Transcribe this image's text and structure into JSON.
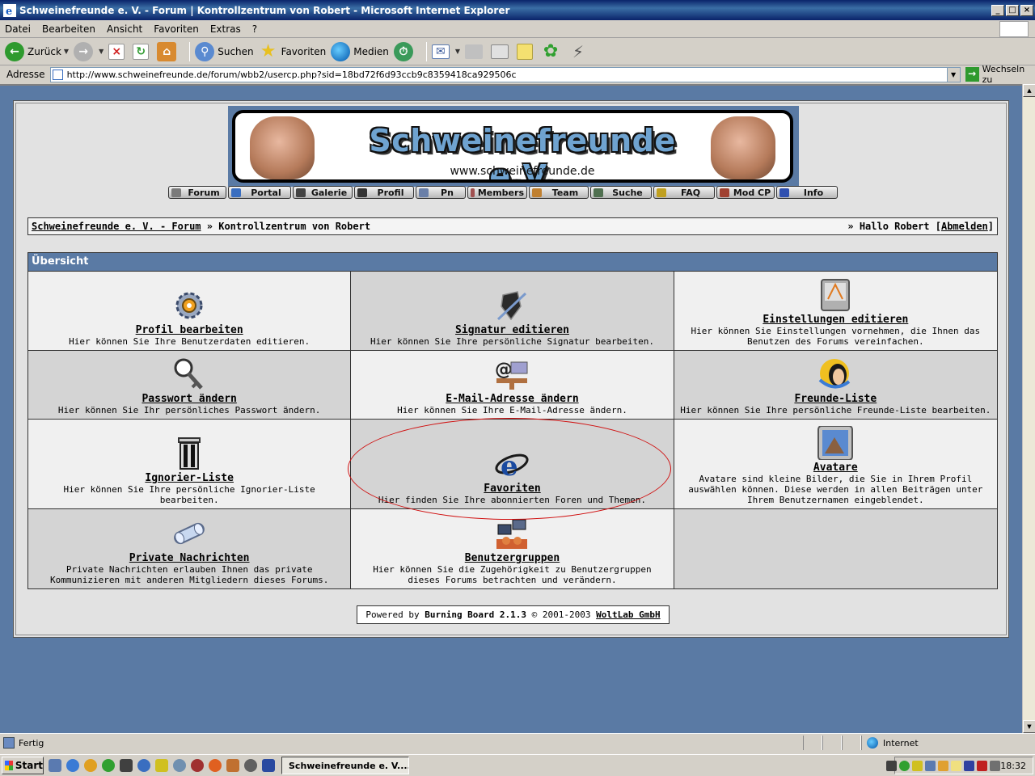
{
  "window": {
    "title": "Schweinefreunde e. V. - Forum | Kontrollzentrum von Robert - Microsoft Internet Explorer",
    "controls": [
      "_",
      "□",
      "×"
    ]
  },
  "menu": {
    "items": [
      "Datei",
      "Bearbeiten",
      "Ansicht",
      "Favoriten",
      "Extras",
      "?"
    ]
  },
  "toolbar": {
    "back": "Zurück",
    "search": "Suchen",
    "favorites": "Favoriten",
    "media": "Medien"
  },
  "address": {
    "label": "Adresse",
    "url": "http://www.schweinefreunde.de/forum/wbb2/usercp.php?sid=18bd72f6d93ccb9c8359418ca929506c",
    "go": "Wechseln zu"
  },
  "banner": {
    "title": "Schweinefreunde e.V.",
    "url": "www.schweinefreunde.de"
  },
  "nav": {
    "items": [
      {
        "label": "Forum",
        "icon": "forum-icon",
        "color": "#7a7a7a"
      },
      {
        "label": "Portal",
        "icon": "portal-icon",
        "color": "#3a6ec0"
      },
      {
        "label": "Galerie",
        "icon": "gallery-icon",
        "color": "#444444"
      },
      {
        "label": "Profil",
        "icon": "profile-icon",
        "color": "#333333"
      },
      {
        "label": "Pn",
        "icon": "pm-icon",
        "color": "#6a7fa8"
      },
      {
        "label": "Members",
        "icon": "members-icon",
        "color": "#a05050"
      },
      {
        "label": "Team",
        "icon": "team-icon",
        "color": "#c08030"
      },
      {
        "label": "Suche",
        "icon": "search-icon",
        "color": "#507050"
      },
      {
        "label": "FAQ",
        "icon": "faq-icon",
        "color": "#c0a020"
      },
      {
        "label": "Mod CP",
        "icon": "modcp-icon",
        "color": "#a04030"
      },
      {
        "label": "Info",
        "icon": "info-icon",
        "color": "#3050b0"
      }
    ]
  },
  "breadcrumb": {
    "home": "Schweinefreunde e. V. - Forum",
    "separator": "»",
    "current": "Kontrollzentrum von Robert",
    "greeting_prefix": "» Hallo Robert [",
    "logout": "Abmelden",
    "greeting_suffix": "]"
  },
  "overview": {
    "header": "Übersicht",
    "cells": [
      {
        "title": "Profil bearbeiten",
        "desc": "Hier können Sie Ihre Benutzerdaten editieren.",
        "icon": "gear-icon"
      },
      {
        "title": "Signatur editieren",
        "desc": "Hier können Sie Ihre persönliche Signatur bearbeiten.",
        "icon": "pen-icon"
      },
      {
        "title": "Einstellungen editieren",
        "desc": "Hier können Sie Einstellungen vornehmen, die Ihnen das Benutzen des Forums vereinfachen.",
        "icon": "settings-icon"
      },
      {
        "title": "Passwort ändern",
        "desc": "Hier können Sie Ihr persönliches Passwort ändern.",
        "icon": "key-icon"
      },
      {
        "title": "E-Mail-Adresse ändern",
        "desc": "Hier können Sie Ihre E-Mail-Adresse ändern.",
        "icon": "email-icon"
      },
      {
        "title": "Freunde-Liste",
        "desc": "Hier können Sie Ihre persönliche Freunde-Liste bearbeiten.",
        "icon": "friends-icon"
      },
      {
        "title": "Ignorier-Liste",
        "desc": "Hier können Sie Ihre persönliche Ignorier-Liste bearbeiten.",
        "icon": "trash-icon"
      },
      {
        "title": "Favoriten",
        "desc": "Hier finden Sie Ihre abonnierten Foren und Themen.",
        "icon": "favorites-icon"
      },
      {
        "title": "Avatare",
        "desc": "Avatare sind kleine Bilder, die Sie in Ihrem Profil auswählen können. Diese werden in allen Beiträgen unter Ihrem Benutzernamen eingeblendet.",
        "icon": "avatar-icon"
      },
      {
        "title": "Private Nachrichten",
        "desc": "Private Nachrichten erlauben Ihnen das private Kommunizieren mit anderen Mitgliedern dieses Forums.",
        "icon": "message-icon"
      },
      {
        "title": "Benutzergruppen",
        "desc": "Hier können Sie die Zugehörigkeit zu Benutzergruppen dieses Forums betrachten und verändern.",
        "icon": "usergroups-icon"
      }
    ]
  },
  "footer": {
    "prefix": "Powered by",
    "product": "Burning Board 2.1.3",
    "years": "© 2001-2003",
    "company": "WoltLab GmbH"
  },
  "status": {
    "text": "Fertig",
    "zone": "Internet"
  },
  "taskbar": {
    "start": "Start",
    "task": "Schweinefreunde e. V....",
    "clock": "18:32"
  }
}
